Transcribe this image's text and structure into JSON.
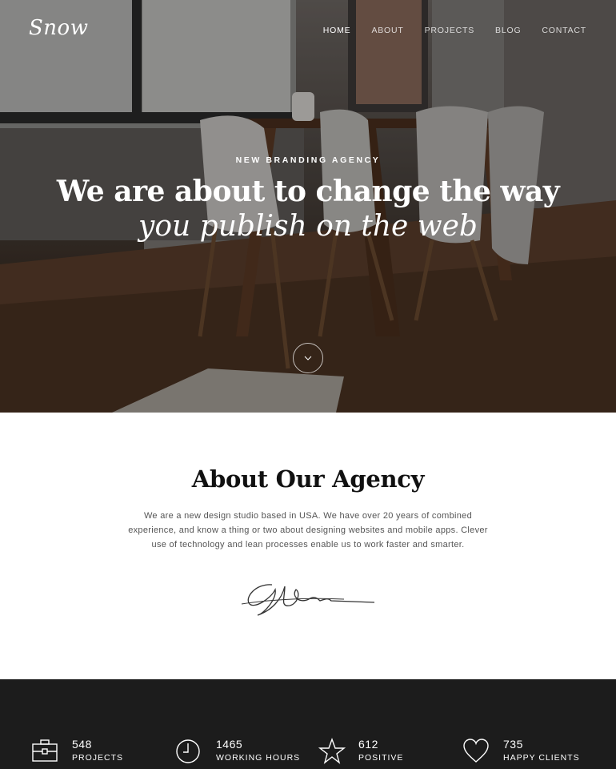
{
  "brand": {
    "logo": "Snow"
  },
  "nav": {
    "items": [
      {
        "label": "HOME",
        "active": true
      },
      {
        "label": "ABOUT",
        "active": false
      },
      {
        "label": "PROJECTS",
        "active": false
      },
      {
        "label": "BLOG",
        "active": false
      },
      {
        "label": "CONTACT",
        "active": false
      }
    ]
  },
  "hero": {
    "eyebrow": "NEW BRANDING AGENCY",
    "headline": "We are about to change the way",
    "headline_italic": "you publish on the web",
    "scroll_icon": "chevron-down-icon"
  },
  "about": {
    "title": "About Our Agency",
    "body": "We are a new design studio based in USA. We have over 20 years of combined experience, and know a thing or two about designing websites and mobile apps. Clever use of technology and lean processes enable us to work faster and smarter.",
    "signature_icon": "signature"
  },
  "stats": [
    {
      "icon": "briefcase-icon",
      "value": "548",
      "label": "PROJECTS"
    },
    {
      "icon": "clock-icon",
      "value": "1465",
      "label": "WORKING HOURS"
    },
    {
      "icon": "star-icon",
      "value": "612",
      "label": "POSITIVE"
    },
    {
      "icon": "heart-icon",
      "value": "735",
      "label": "HAPPY CLIENTS"
    }
  ],
  "colors": {
    "dark": "#1c1c1c",
    "text": "#111111",
    "muted": "#555555"
  }
}
